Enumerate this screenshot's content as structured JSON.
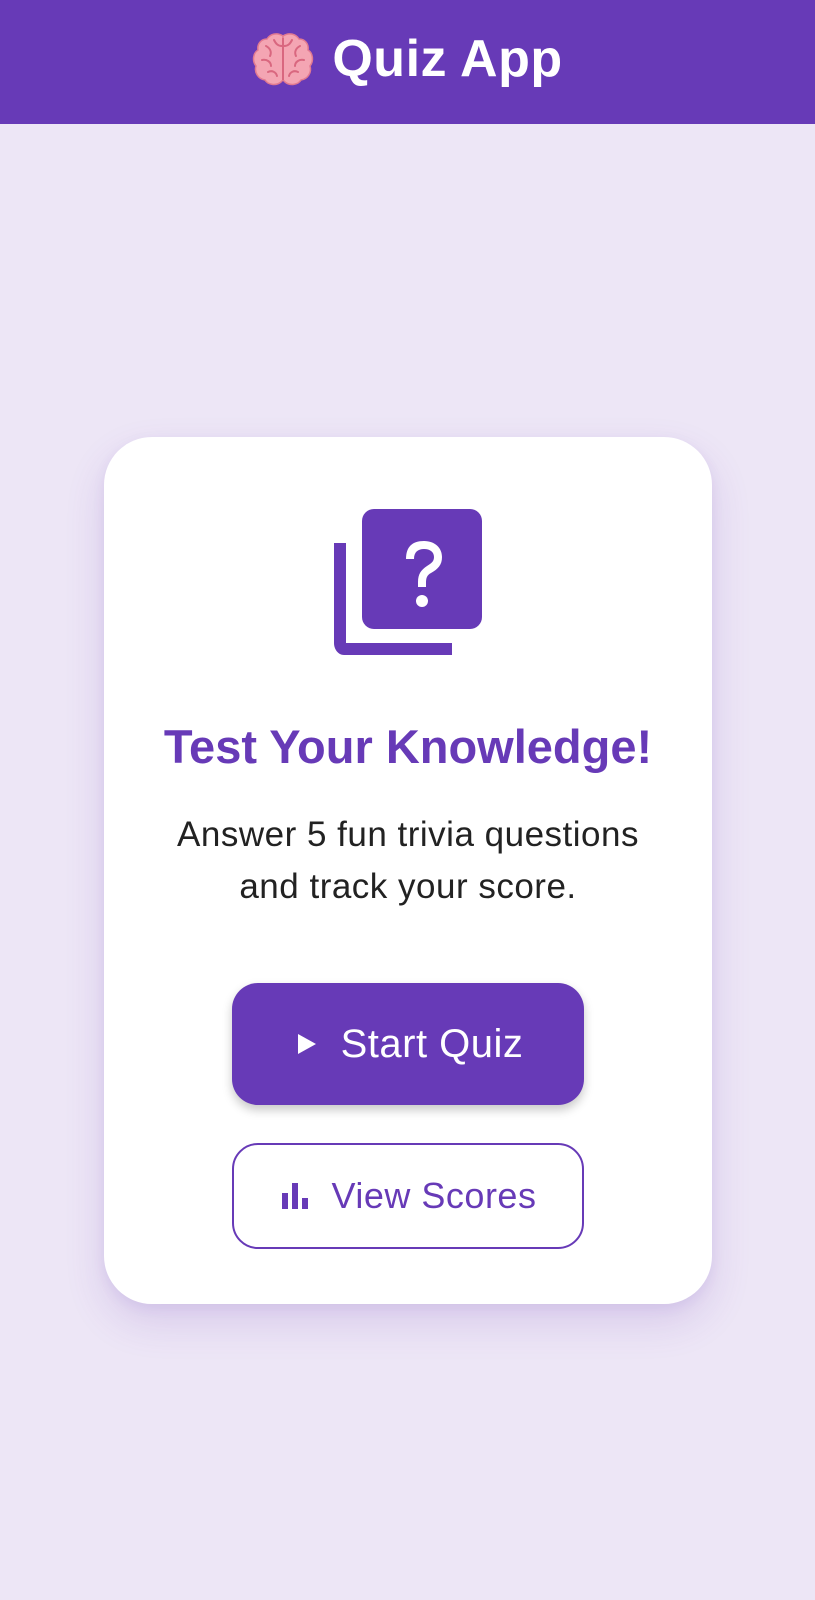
{
  "app_bar": {
    "title": "Quiz App",
    "icon": "brain-icon",
    "background": "#673ab7"
  },
  "card": {
    "icon": "quiz-icon",
    "title": "Test Your Knowledge!",
    "description": "Answer 5 fun trivia questions and track your score.",
    "start_button": {
      "label": "Start Quiz",
      "icon": "play-icon"
    },
    "scores_button": {
      "label": "View Scores",
      "icon": "bar-chart-icon"
    }
  },
  "colors": {
    "primary": "#673ab7",
    "background": "#ede6f6",
    "card": "#ffffff",
    "text": "#222222"
  }
}
